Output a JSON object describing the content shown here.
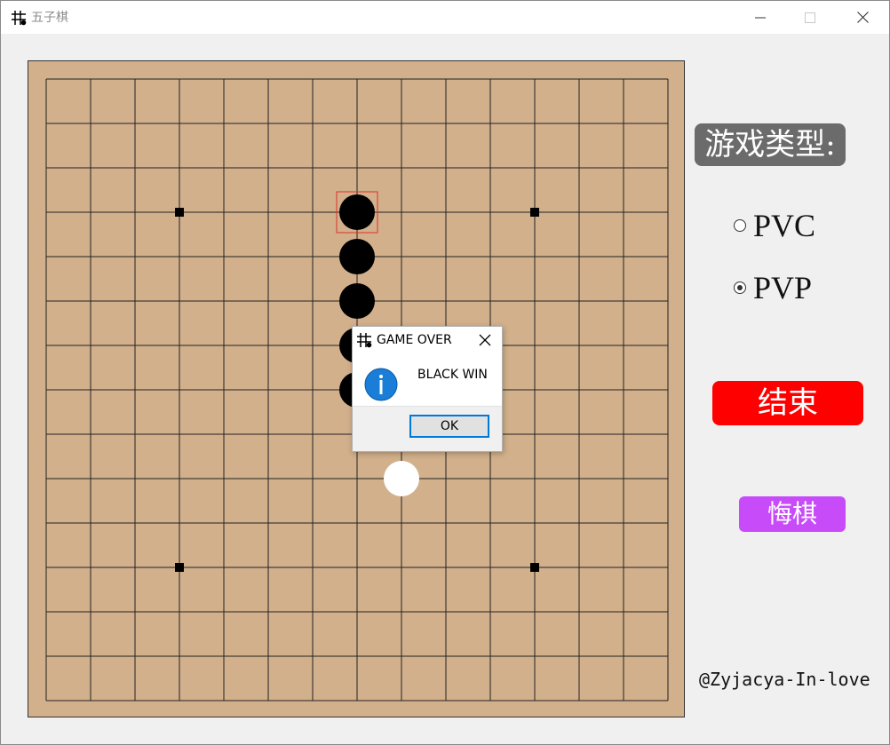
{
  "window": {
    "title": "五子棋"
  },
  "board": {
    "size": 15,
    "background": "#d2b08c",
    "star_points": [
      [
        3,
        3
      ],
      [
        11,
        3
      ],
      [
        3,
        11
      ],
      [
        11,
        11
      ]
    ],
    "stones": [
      {
        "col": 7,
        "row": 3,
        "color": "black",
        "last": true
      },
      {
        "col": 7,
        "row": 4,
        "color": "black"
      },
      {
        "col": 7,
        "row": 5,
        "color": "black"
      },
      {
        "col": 7,
        "row": 6,
        "color": "black"
      },
      {
        "col": 7,
        "row": 7,
        "color": "black"
      },
      {
        "col": 8,
        "row": 9,
        "color": "white"
      }
    ]
  },
  "sidebar": {
    "game_type_label": "游戏类型:",
    "modes": [
      {
        "label": "PVC",
        "selected": false
      },
      {
        "label": "PVP",
        "selected": true
      }
    ],
    "end_button": "结束",
    "undo_button": "悔棋",
    "credit": "@Zyjacya-In-love",
    "colors": {
      "end": "#ff0000",
      "undo": "#c84bfa",
      "title_bg": "#6b6b6b"
    }
  },
  "dialog": {
    "title": "GAME OVER",
    "message": "BLACK WIN",
    "ok_label": "OK",
    "icon": "info-icon"
  }
}
